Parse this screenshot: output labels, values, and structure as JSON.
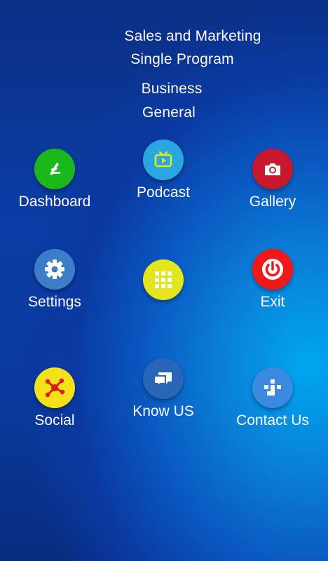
{
  "header": {
    "line1": "Sales and Marketing",
    "line2": "Single Program",
    "line3": "Business",
    "line4": "General"
  },
  "tiles": {
    "dashboard": {
      "label": "Dashboard",
      "icon": "dashboard-icon",
      "color": "#1bb81b"
    },
    "podcast": {
      "label": "Podcast",
      "icon": "tv-icon",
      "color": "#2aa7e0"
    },
    "gallery": {
      "label": "Gallery",
      "icon": "camera-icon",
      "color": "#c8182e"
    },
    "settings": {
      "label": "Settings",
      "icon": "gear-icon",
      "color": "#3d7cc8"
    },
    "apps": {
      "label": "",
      "icon": "grid-icon",
      "color": "#e3e61b"
    },
    "exit": {
      "label": "Exit",
      "icon": "power-icon",
      "color": "#f01818"
    },
    "social": {
      "label": "Social",
      "icon": "network-icon",
      "color": "#f3e21a"
    },
    "know_us": {
      "label": "Know US",
      "icon": "chat-bubbles-icon",
      "color": "#2a66b8"
    },
    "contact_us": {
      "label": "Contact Us",
      "icon": "contact-icon",
      "color": "#3a8ae0"
    }
  }
}
